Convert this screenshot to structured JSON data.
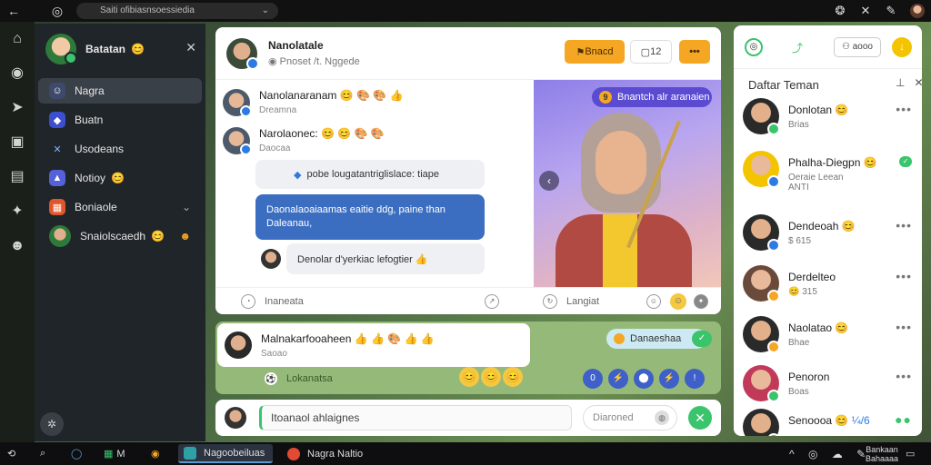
{
  "browser": {
    "address": "Saiti ofibiasnsoessiedia",
    "icons": [
      "back-icon",
      "chrome-icon",
      "tab-icon"
    ]
  },
  "sidebar": {
    "title": "Batatan",
    "title_emoji": "😊",
    "items": [
      {
        "label": "Nagra",
        "icon": "people-icon",
        "active": true
      },
      {
        "label": "Buatn",
        "icon": "shield-icon"
      },
      {
        "label": "Usodeans",
        "icon": "tools-icon"
      },
      {
        "label": "Notioy",
        "icon": "bell-icon",
        "emoji": "😊"
      },
      {
        "label": "Boniaole",
        "icon": "calendar-icon",
        "has_caret": true
      },
      {
        "label": "Snaiolscaedh",
        "icon": "avatar",
        "emoji": "😊"
      }
    ]
  },
  "main": {
    "header": {
      "title": "Nanolatale",
      "subtitle": "Pnoset /t. Nggede",
      "btn_primary": "Bnacd",
      "btn_count": "12",
      "btn_more": "•••"
    },
    "posts": [
      {
        "name": "Nanolanaranam",
        "emojis": "😊 🎨 🎨 👍",
        "status": "Dreamna"
      },
      {
        "name": "Narolaonec:",
        "emojis": "😊 😊 🎨 🎨",
        "status": "Daocaa"
      }
    ],
    "messages": [
      "pobe lougatantriglislace: tiape",
      "Daonalaoaiaamas eaitie ddg, paine than Daleanau,",
      "Denolar d'yerkiac lefogtier 👍"
    ],
    "image_tag": "Bnantch alr aranaien",
    "footer": {
      "comments": "Inaneata",
      "shares": "Langiat"
    }
  },
  "post2": {
    "name": "Malnakarfooaheen",
    "emojis": "👍 👍 🎨 👍 👍",
    "status": "Saoao",
    "pill": "Danaeshaa",
    "meta": "Lokanatsa",
    "reactions": [
      "😊",
      "😊",
      "😊"
    ],
    "actions": [
      "0",
      "⚡",
      "⬤",
      "⚡",
      "!"
    ]
  },
  "composer": {
    "placeholder": "Itoanaol ahlaignes",
    "secondary": "Diaroned"
  },
  "right_panel": {
    "title": "Daftar Teman",
    "top_btn": "aooo",
    "friends": [
      {
        "name": "Donlotan",
        "emoji": "😊",
        "status": "Brias",
        "dot": "#3ac46b"
      },
      {
        "name": "Phalha-Diegpn",
        "emoji": "😊",
        "status": "Oeraie Leean",
        "extra": "ANTI",
        "dot": "#2c7be5",
        "badge": "✓"
      },
      {
        "name": "Dendeoah",
        "emoji": "😊",
        "status": "$ 615",
        "dot": "#2c7be5"
      },
      {
        "name": "Derdelteo",
        "emoji": "",
        "status": "😊 315",
        "dot": "#f5a623"
      },
      {
        "name": "Naolatao",
        "emoji": "😊",
        "status": "Bhae",
        "dot": "#f5a623"
      },
      {
        "name": "Penoron",
        "emoji": "",
        "status": "Boas",
        "dot": "#3ac46b"
      },
      {
        "name": "Senoooa",
        "emoji": "😊",
        "status": "¼/6",
        "dot": "#3ac46b"
      }
    ]
  },
  "taskbar": {
    "apps": [
      {
        "label": "Nagoobeiluas",
        "active": true,
        "color": "#2ea0a6"
      },
      {
        "label": "Nagra Naltio",
        "active": false,
        "color": "#e24a33"
      }
    ],
    "clock_time": "Bankaan",
    "clock_date": "Bahaaaa"
  }
}
